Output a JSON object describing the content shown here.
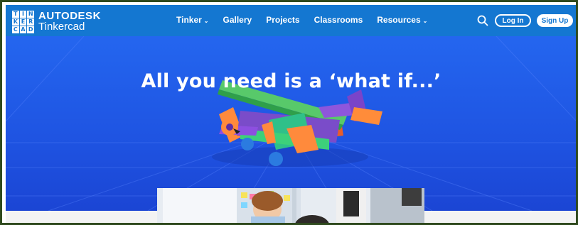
{
  "brand": {
    "logo_letters": [
      "T",
      "I",
      "N",
      "K",
      "E",
      "R",
      "C",
      "A",
      "D"
    ],
    "company": "AUTODESK",
    "product": "Tinkercad"
  },
  "nav": {
    "items": [
      {
        "label": "Tinker",
        "has_dropdown": true
      },
      {
        "label": "Gallery",
        "has_dropdown": false
      },
      {
        "label": "Projects",
        "has_dropdown": false
      },
      {
        "label": "Classrooms",
        "has_dropdown": false
      },
      {
        "label": "Resources",
        "has_dropdown": true
      }
    ],
    "chevron": "⌄"
  },
  "header_actions": {
    "search_icon": "search-icon",
    "login_label": "Log In",
    "signup_label": "Sign Up"
  },
  "hero": {
    "title": "All you need is a ‘what if...’"
  },
  "colors": {
    "nav_blue": "#1477d1",
    "hero_blue": "#2466ef",
    "frame_green": "#2f4a1e"
  }
}
